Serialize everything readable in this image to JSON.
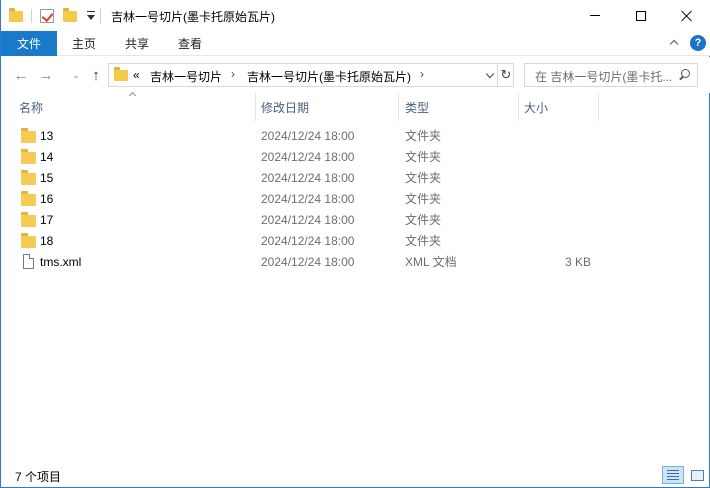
{
  "window": {
    "title": "吉林一号切片(墨卡托原始瓦片)"
  },
  "ribbon": {
    "file_label": "文件",
    "home_label": "主页",
    "share_label": "共享",
    "view_label": "查看",
    "help_glyph": "?"
  },
  "address": {
    "overflow_glyph": "«",
    "crumbs": [
      "吉林一号切片",
      "吉林一号切片(墨卡托原始瓦片)"
    ],
    "chevron": "›"
  },
  "search": {
    "placeholder": "在 吉林一号切片(墨卡托..."
  },
  "columns": {
    "name": "名称",
    "modified": "修改日期",
    "type": "类型",
    "size": "大小"
  },
  "files": [
    {
      "name": "13",
      "modified": "2024/12/24 18:00",
      "type": "文件夹",
      "size": "",
      "icon": "folder-icon"
    },
    {
      "name": "14",
      "modified": "2024/12/24 18:00",
      "type": "文件夹",
      "size": "",
      "icon": "folder-icon"
    },
    {
      "name": "15",
      "modified": "2024/12/24 18:00",
      "type": "文件夹",
      "size": "",
      "icon": "folder-icon"
    },
    {
      "name": "16",
      "modified": "2024/12/24 18:00",
      "type": "文件夹",
      "size": "",
      "icon": "folder-icon"
    },
    {
      "name": "17",
      "modified": "2024/12/24 18:00",
      "type": "文件夹",
      "size": "",
      "icon": "folder-icon"
    },
    {
      "name": "18",
      "modified": "2024/12/24 18:00",
      "type": "文件夹",
      "size": "",
      "icon": "folder-icon"
    },
    {
      "name": "tms.xml",
      "modified": "2024/12/24 18:00",
      "type": "XML 文档",
      "size": "3 KB",
      "icon": "xml-file-icon"
    }
  ],
  "status": {
    "item_count": "7 个项目"
  },
  "colors": {
    "accent": "#1979ca",
    "folder": "#f5cb53",
    "column_header_text": "#4c607a",
    "secondary_text": "#6d6d6d"
  }
}
